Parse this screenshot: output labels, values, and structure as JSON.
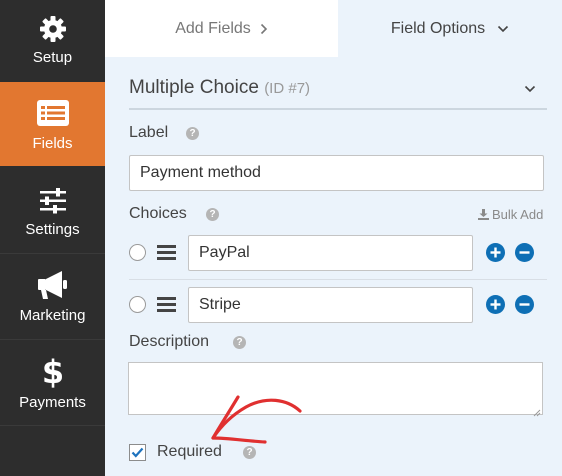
{
  "sidebar": {
    "items": [
      {
        "label": "Setup",
        "icon": "gear-icon"
      },
      {
        "label": "Fields",
        "icon": "list-icon",
        "active": true
      },
      {
        "label": "Settings",
        "icon": "sliders-icon"
      },
      {
        "label": "Marketing",
        "icon": "megaphone-icon"
      },
      {
        "label": "Payments",
        "icon": "dollar-icon"
      }
    ]
  },
  "tabs": {
    "add_fields": "Add Fields",
    "field_options": "Field Options"
  },
  "field": {
    "type_title": "Multiple Choice",
    "id_label": "(ID #7)",
    "label_heading": "Label",
    "label_value": "Payment method",
    "choices_heading": "Choices",
    "bulk_add": "Bulk Add",
    "choices": [
      "PayPal",
      "Stripe"
    ],
    "description_heading": "Description",
    "description_value": "",
    "required_label": "Required",
    "required_checked": true
  },
  "colors": {
    "sidebar_bg": "#2d2d2d",
    "active_accent": "#e27730",
    "panel_bg": "#ebf3fb",
    "button_blue": "#0e6fb5",
    "arrow_red": "#e03030"
  }
}
